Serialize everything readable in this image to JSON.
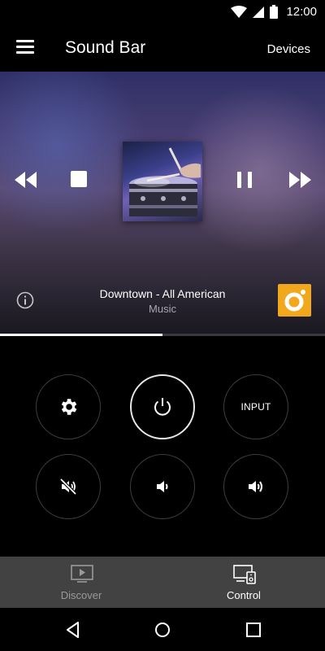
{
  "status_bar": {
    "time": "12:00"
  },
  "app_bar": {
    "title": "Sound Bar",
    "devices_label": "Devices"
  },
  "now_playing": {
    "track": "Downtown - All American",
    "source": "Music",
    "progress": 0.5
  },
  "remote": {
    "input_label": "INPUT"
  },
  "tabs": [
    {
      "label": "Discover",
      "active": false
    },
    {
      "label": "Control",
      "active": true
    }
  ],
  "colors": {
    "background": "#000000",
    "accent_badge": "#f2a81d",
    "tab_bar": "#424242",
    "inactive_tab": "#9a9a9a"
  },
  "icons": [
    "wifi-icon",
    "signal-icon",
    "battery-icon",
    "menu-icon",
    "rewind-icon",
    "stop-icon",
    "pause-icon",
    "fast-forward-icon",
    "info-icon",
    "music-source-icon",
    "settings-icon",
    "power-icon",
    "mute-icon",
    "volume-down-icon",
    "volume-up-icon",
    "discover-icon",
    "control-icon",
    "back-icon",
    "home-icon",
    "recents-icon"
  ]
}
